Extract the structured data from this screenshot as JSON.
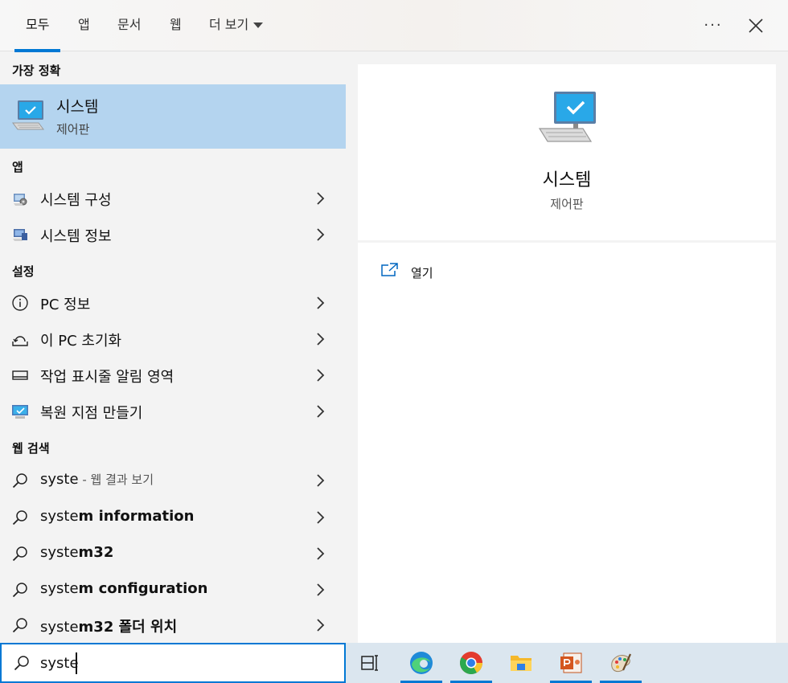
{
  "tabs": [
    {
      "label": "모두",
      "active": true
    },
    {
      "label": "앱"
    },
    {
      "label": "문서"
    },
    {
      "label": "웹"
    },
    {
      "label": "더 보기"
    }
  ],
  "header": {
    "more_label": "···"
  },
  "sections": {
    "best_match": "가장 정확",
    "apps": "앱",
    "settings": "설정",
    "web": "웹 검색"
  },
  "best_match": {
    "title": "시스템",
    "subtitle": "제어판"
  },
  "apps": [
    {
      "label": "시스템 구성",
      "icon": "system-config-icon"
    },
    {
      "label": "시스템 정보",
      "icon": "system-info-icon"
    }
  ],
  "settings": [
    {
      "label": "PC 정보",
      "icon": "info-icon"
    },
    {
      "label": "이 PC 초기화",
      "icon": "reset-pc-icon"
    },
    {
      "label": "작업 표시줄 알림 영역",
      "icon": "taskbar-icon"
    },
    {
      "label": "복원 지점 만들기",
      "icon": "restore-point-icon"
    }
  ],
  "web": [
    {
      "query": "syste",
      "bold": "",
      "hint": " - 웹 결과 보기"
    },
    {
      "query": "syste",
      "bold": "m information",
      "hint": ""
    },
    {
      "query": "syste",
      "bold": "m32",
      "hint": ""
    },
    {
      "query": "syste",
      "bold": "m configuration",
      "hint": ""
    },
    {
      "query": "syste",
      "bold": "m32 폴더 위치",
      "hint": ""
    }
  ],
  "preview": {
    "title": "시스템",
    "subtitle": "제어판",
    "actions": [
      {
        "label": "열기",
        "icon": "open-icon"
      }
    ]
  },
  "search": {
    "value": "syste",
    "placeholder": ""
  },
  "taskbar": [
    {
      "name": "task-view-icon",
      "running": false
    },
    {
      "name": "edge-icon",
      "running": true
    },
    {
      "name": "chrome-icon",
      "running": true
    },
    {
      "name": "file-explorer-icon",
      "running": false
    },
    {
      "name": "powerpoint-icon",
      "running": true
    },
    {
      "name": "paint-icon",
      "running": true
    }
  ],
  "colors": {
    "accent": "#0078d4",
    "selected": "#b4d4ef",
    "taskbar": "#dbe6ef"
  }
}
